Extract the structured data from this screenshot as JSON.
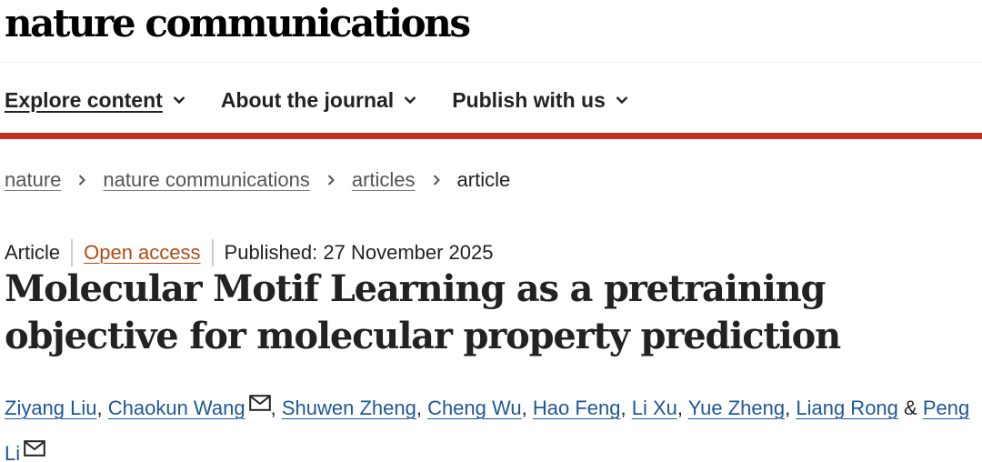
{
  "header": {
    "journal_name": "nature communications"
  },
  "nav": {
    "items": [
      {
        "label": "Explore content",
        "active": true,
        "icon": "chevron-down-icon"
      },
      {
        "label": "About the journal",
        "active": false,
        "icon": "chevron-down-icon"
      },
      {
        "label": "Publish with us",
        "active": false,
        "icon": "chevron-down-icon"
      }
    ]
  },
  "breadcrumb": {
    "items": [
      "nature",
      "nature communications",
      "articles"
    ],
    "current": "article",
    "separator_icon": "chevron-right-icon"
  },
  "article": {
    "type": "Article",
    "access": "Open access",
    "published": "Published: 27 November 2025",
    "title": "Molecular Motif Learning as a pretraining objective for molecular property prediction",
    "authors": [
      {
        "name": "Ziyang Liu",
        "mail": false,
        "after": ", "
      },
      {
        "name": "Chaokun Wang",
        "mail": true,
        "after": ", "
      },
      {
        "name": "Shuwen Zheng",
        "mail": false,
        "after": ", "
      },
      {
        "name": "Cheng Wu",
        "mail": false,
        "after": ", "
      },
      {
        "name": "Hao Feng",
        "mail": false,
        "after": ", "
      },
      {
        "name": "Li Xu",
        "mail": false,
        "after": ", "
      },
      {
        "name": "Yue Zheng",
        "mail": false,
        "after": ", "
      },
      {
        "name": "Liang Rong",
        "mail": false,
        "after": " & "
      },
      {
        "name": "Peng Li",
        "mail": true,
        "after": ""
      }
    ]
  },
  "colors": {
    "accent_rule": "#c0301f",
    "open_access": "#b04a14",
    "author_link": "#1d5799"
  }
}
